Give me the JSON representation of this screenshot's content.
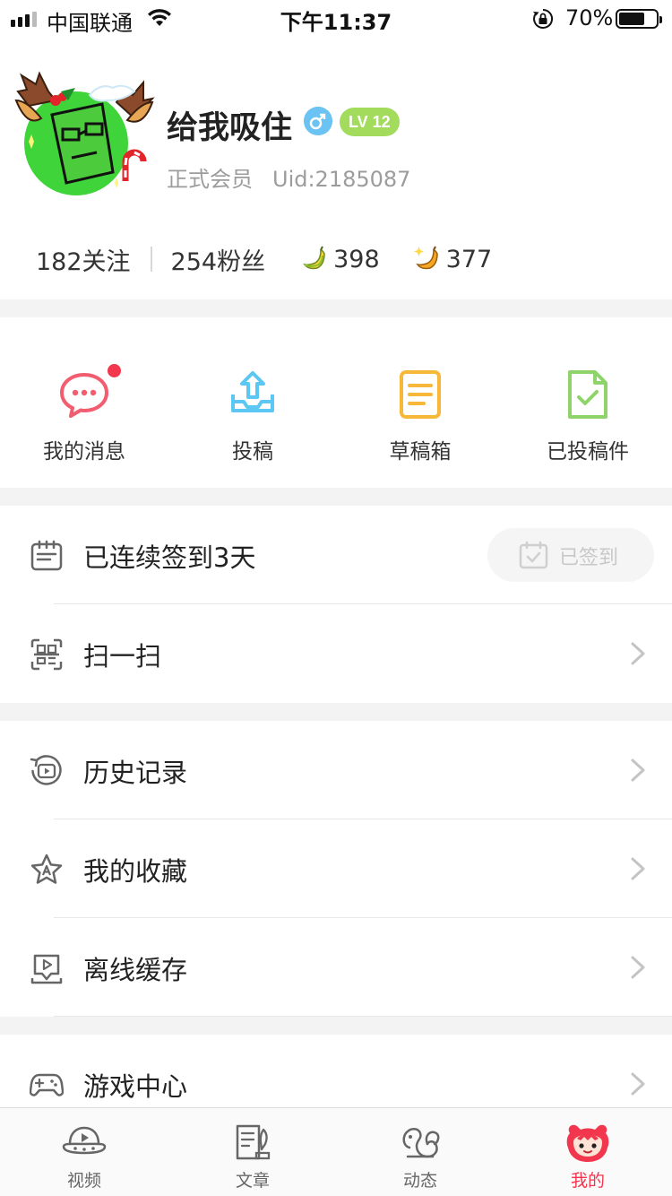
{
  "status_bar": {
    "carrier": "中国联通",
    "time": "下午11:37",
    "battery_percent": "70%",
    "battery_level": 0.7
  },
  "profile": {
    "username": "给我吸住",
    "gender_icon": "male-symbol-icon",
    "level": "LV 12",
    "membership": "正式会员",
    "uid": "Uid:2185087",
    "following": "182关注",
    "followers": "254粉丝",
    "banana_count": "398",
    "gold_banana_count": "377"
  },
  "quick_actions": [
    {
      "label": "我的消息",
      "icon": "message-bubble-icon",
      "color": "#f25d6f",
      "has_notification": true
    },
    {
      "label": "投稿",
      "icon": "upload-icon",
      "color": "#5cc7f2"
    },
    {
      "label": "草稿箱",
      "icon": "draft-box-icon",
      "color": "#f7b83a"
    },
    {
      "label": "已投稿件",
      "icon": "submitted-document-icon",
      "color": "#8fd46a"
    }
  ],
  "checkin": {
    "label": "已连续签到3天",
    "button_label": "已签到"
  },
  "list": {
    "scan": "扫一扫",
    "history": "历史记录",
    "favorites": "我的收藏",
    "offline_cache": "离线缓存",
    "game_center": "游戏中心"
  },
  "tabs": [
    {
      "label": "视频",
      "icon": "video-ufo-icon",
      "active": false
    },
    {
      "label": "文章",
      "icon": "article-icon",
      "active": false
    },
    {
      "label": "动态",
      "icon": "squirrel-icon",
      "active": false
    },
    {
      "label": "我的",
      "icon": "mascot-face-icon",
      "active": true
    }
  ],
  "colors": {
    "accent": "#f2364d",
    "level_badge": "#a3dc5d",
    "gender_badge": "#6bc3f3"
  }
}
